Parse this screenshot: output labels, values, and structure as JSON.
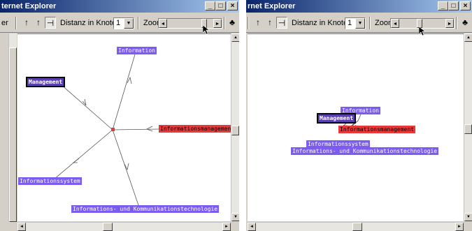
{
  "windows": [
    {
      "title": "ternet Explorer",
      "toolbar": {
        "prefix": "er",
        "distance_label": "Distanz in Knoten",
        "distance_value": "1",
        "zoom_label": "Zoom",
        "zoom_level": 0.87
      },
      "nodes": {
        "information": "Information",
        "management": "Management",
        "informationsmanagement": "Informationsmanagement",
        "informationssystem": "Informationssystem",
        "ikt": "Informations- und Kommunikationstechnologie"
      }
    },
    {
      "title": "rnet Explorer",
      "toolbar": {
        "distance_label": "Distanz in Knoten",
        "distance_value": "1",
        "zoom_label": "Zoom",
        "zoom_level": 0.45
      },
      "nodes": {
        "information": "Information",
        "management": "Management",
        "informationsmanagement": "Informationsmanagement",
        "informationssystem": "Informationssystem",
        "ikt": "Informations- und Kommunikationstechnologie"
      }
    }
  ],
  "icons": [
    "arrow-up-icon",
    "arrow-up-icon",
    "pin-icon",
    "tree-icon",
    "minimize-icon",
    "maximize-icon",
    "close-icon"
  ],
  "colors": {
    "node_purple": "#7c5cf0",
    "node_red": "#e8393a",
    "selected_node": "#5b3fb0",
    "titlebar": "#0a246a"
  }
}
